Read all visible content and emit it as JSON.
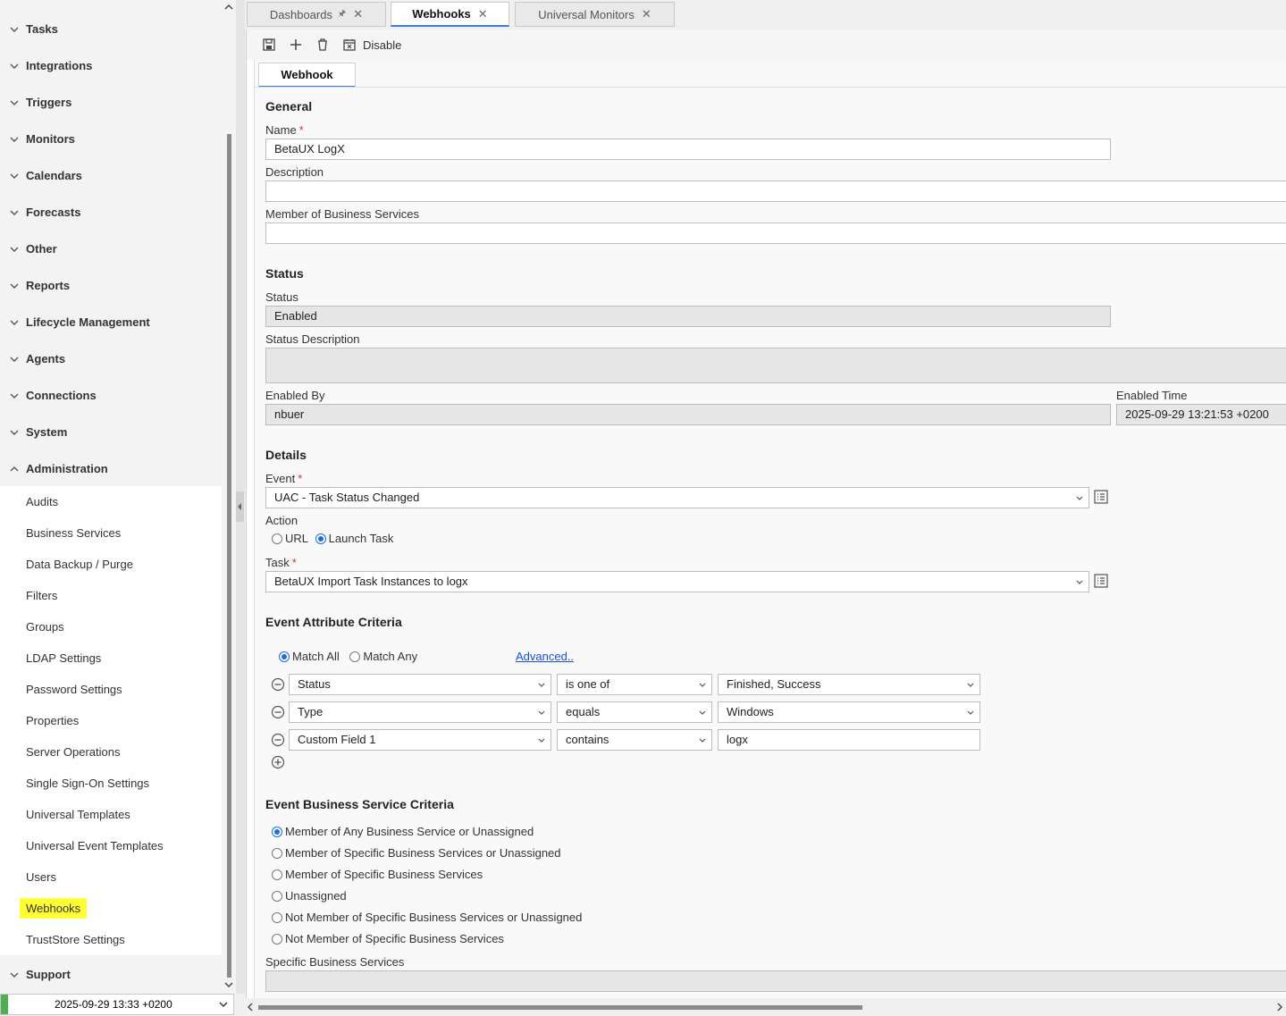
{
  "sidebar": {
    "groups": [
      {
        "label": "Tasks",
        "expanded": false
      },
      {
        "label": "Integrations",
        "expanded": false
      },
      {
        "label": "Triggers",
        "expanded": false
      },
      {
        "label": "Monitors",
        "expanded": false
      },
      {
        "label": "Calendars",
        "expanded": false
      },
      {
        "label": "Forecasts",
        "expanded": false
      },
      {
        "label": "Other",
        "expanded": false
      },
      {
        "label": "Reports",
        "expanded": false
      },
      {
        "label": "Lifecycle Management",
        "expanded": false
      },
      {
        "label": "Agents",
        "expanded": false
      },
      {
        "label": "Connections",
        "expanded": false
      },
      {
        "label": "System",
        "expanded": false
      },
      {
        "label": "Administration",
        "expanded": true
      }
    ],
    "admin_items": [
      "Audits",
      "Business Services",
      "Data Backup / Purge",
      "Filters",
      "Groups",
      "LDAP Settings",
      "Password Settings",
      "Properties",
      "Server Operations",
      "Single Sign-On Settings",
      "Universal Templates",
      "Universal Event Templates",
      "Users",
      "Webhooks",
      "TrustStore Settings"
    ],
    "active_item": "Webhooks",
    "support_label": "Support"
  },
  "status_bar": {
    "datetime": "2025-09-29 13:33 +0200"
  },
  "tabs": [
    {
      "label": "Dashboards",
      "pinned": true,
      "active": false
    },
    {
      "label": "Webhooks",
      "pinned": false,
      "active": true
    },
    {
      "label": "Universal Monitors",
      "pinned": false,
      "active": false
    }
  ],
  "toolbar": {
    "disable_label": "Disable",
    "icons": [
      "save-icon",
      "add-icon",
      "delete-icon",
      "disable-icon"
    ]
  },
  "subtab": "Webhook",
  "general": {
    "section": "General",
    "name_label": "Name",
    "name_value": "BetaUX LogX",
    "description_label": "Description",
    "description_value": "",
    "member_label": "Member of Business Services",
    "member_value": ""
  },
  "status": {
    "section": "Status",
    "status_label": "Status",
    "status_value": "Enabled",
    "status_desc_label": "Status Description",
    "status_desc_value": "",
    "enabled_by_label": "Enabled By",
    "enabled_by_value": "nbuer",
    "enabled_time_label": "Enabled Time",
    "enabled_time_value": "2025-09-29 13:21:53 +0200"
  },
  "details": {
    "section": "Details",
    "event_label": "Event",
    "event_value": "UAC - Task Status Changed",
    "action_label": "Action",
    "action_url": "URL",
    "action_launch": "Launch Task",
    "action_selected": "Launch Task",
    "task_label": "Task",
    "task_value": "BetaUX Import Task Instances to logx"
  },
  "criteria": {
    "section": "Event Attribute Criteria",
    "match_all": "Match All",
    "match_any": "Match Any",
    "match_selected": "Match All",
    "advanced": "Advanced..",
    "rows": [
      {
        "field": "Status",
        "op": "is one of",
        "value": "Finished, Success",
        "value_is_select": true
      },
      {
        "field": "Type",
        "op": "equals",
        "value": "Windows",
        "value_is_select": true
      },
      {
        "field": "Custom Field 1",
        "op": "contains",
        "value": "logx",
        "value_is_select": false
      }
    ]
  },
  "bs_criteria": {
    "section": "Event Business Service Criteria",
    "options": [
      "Member of Any Business Service or Unassigned",
      "Member of Specific Business Services or Unassigned",
      "Member of Specific Business Services",
      "Unassigned",
      "Not Member of Specific Business Services or Unassigned",
      "Not Member of Specific Business Services"
    ],
    "selected_index": 0,
    "specific_label": "Specific Business Services",
    "specific_value": ""
  },
  "colors": {
    "accent": "#3d7bd9",
    "highlight": "#ffff33",
    "required": "#dd3333",
    "status_green": "#4caf50"
  }
}
